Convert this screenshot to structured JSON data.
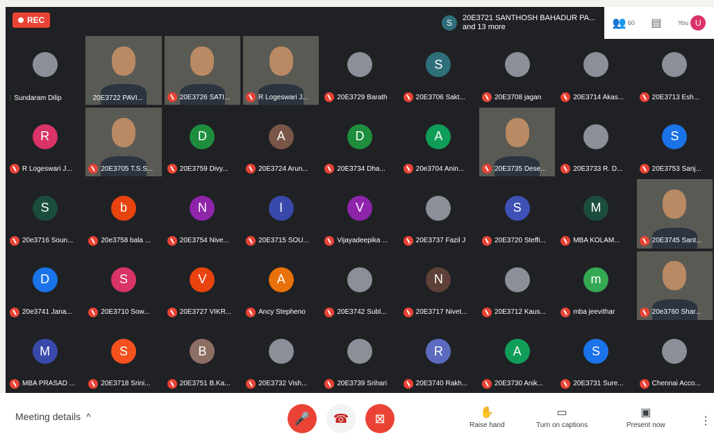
{
  "recording": {
    "label": "REC"
  },
  "presenters": {
    "initial": "S",
    "line1": "20E3721 SANTHOSH BAHADUR PA...",
    "line2": "and 13 more"
  },
  "top_right": {
    "people_count": "60",
    "you_label": "You",
    "you_initial": "U"
  },
  "participants": [
    {
      "name": "Sundaram Dilip",
      "type": "photo",
      "talking": true
    },
    {
      "name": "20E3722 PAVI...",
      "type": "video",
      "talking": true
    },
    {
      "name": "20E3726 SATI...",
      "type": "video"
    },
    {
      "name": "R Logeswari J...",
      "type": "video"
    },
    {
      "name": "20E3729 Barath",
      "type": "photo"
    },
    {
      "name": "20E3706 Sakt...",
      "type": "initial",
      "initial": "S",
      "color": "#2f6f7a"
    },
    {
      "name": "20E3708 jagan",
      "type": "photo"
    },
    {
      "name": "20E3714 Akas...",
      "type": "photo"
    },
    {
      "name": "20E3713 Esh...",
      "type": "photo"
    },
    {
      "name": "R Logeswari J...",
      "type": "initial",
      "initial": "R",
      "color": "#d93368"
    },
    {
      "name": "20E3705 T.S.S...",
      "type": "video"
    },
    {
      "name": "20E3759 Divy...",
      "type": "initial",
      "initial": "D",
      "color": "#1e8e3e"
    },
    {
      "name": "20E3724 Arun...",
      "type": "initial",
      "initial": "A",
      "color": "#795548"
    },
    {
      "name": "20E3734 Dha...",
      "type": "initial",
      "initial": "D",
      "color": "#1e8e3e"
    },
    {
      "name": "20e3704 Anin...",
      "type": "initial",
      "initial": "A",
      "color": "#0f9d58"
    },
    {
      "name": "20E3735 Dese...",
      "type": "video"
    },
    {
      "name": "20E3733 R. D...",
      "type": "photo"
    },
    {
      "name": "20E3753 Sanj...",
      "type": "initial",
      "initial": "S",
      "color": "#1a73e8"
    },
    {
      "name": "20e3716 Soun...",
      "type": "initial",
      "initial": "S",
      "color": "#1b4d3e"
    },
    {
      "name": "20e3758 bala ...",
      "type": "initial",
      "initial": "b",
      "color": "#e8430f"
    },
    {
      "name": "20E3754 Nive...",
      "type": "initial",
      "initial": "N",
      "color": "#8e24aa"
    },
    {
      "name": "20E3715 SOU...",
      "type": "initial",
      "initial": "I",
      "color": "#3949ab"
    },
    {
      "name": "Vijayadeepika ...",
      "type": "initial",
      "initial": "V",
      "color": "#8e24aa"
    },
    {
      "name": "20E3737 Fazil J",
      "type": "photo"
    },
    {
      "name": "20E3720 Steffi...",
      "type": "initial",
      "initial": "S",
      "color": "#3f51b5"
    },
    {
      "name": "MBA KOLAM...",
      "type": "initial",
      "initial": "M",
      "color": "#1b4d3e"
    },
    {
      "name": "20E3745 Sant...",
      "type": "video"
    },
    {
      "name": "20e3741 Jana...",
      "type": "initial",
      "initial": "D",
      "color": "#1a73e8"
    },
    {
      "name": "20E3710 Sow...",
      "type": "initial",
      "initial": "S",
      "color": "#d93368"
    },
    {
      "name": "20E3727 VIKR...",
      "type": "initial",
      "initial": "V",
      "color": "#e8430f"
    },
    {
      "name": "Ancy Stepheno",
      "type": "initial",
      "initial": "A",
      "color": "#e8710a"
    },
    {
      "name": "20E3742 Subl...",
      "type": "photo"
    },
    {
      "name": "20E3717 Nivet...",
      "type": "initial",
      "initial": "N",
      "color": "#5d4037"
    },
    {
      "name": "20E3712 Kaus...",
      "type": "photo"
    },
    {
      "name": "mba jeevithar",
      "type": "initial",
      "initial": "m",
      "color": "#34a853"
    },
    {
      "name": "20e3760 Shar...",
      "type": "video"
    },
    {
      "name": "MBA PRASAD ...",
      "type": "initial",
      "initial": "M",
      "color": "#3949ab"
    },
    {
      "name": "20E3718 Srini...",
      "type": "initial",
      "initial": "S",
      "color": "#f4511e"
    },
    {
      "name": "20E3751 B.Ka...",
      "type": "initial",
      "initial": "B",
      "color": "#8d6e63"
    },
    {
      "name": "20E3732 Vish...",
      "type": "photo"
    },
    {
      "name": "20E3739 Srihari",
      "type": "photo"
    },
    {
      "name": "20E3740 Rakh...",
      "type": "initial",
      "initial": "R",
      "color": "#5c6bc0"
    },
    {
      "name": "20E3730 Anik...",
      "type": "initial",
      "initial": "A",
      "color": "#0f9d58"
    },
    {
      "name": "20E3731 Sure...",
      "type": "initial",
      "initial": "S",
      "color": "#1a73e8"
    },
    {
      "name": "Chennai Acco...",
      "type": "photo"
    }
  ],
  "bottom_bar": {
    "meeting_details": "Meeting details",
    "raise_hand": "Raise hand",
    "captions": "Turn on captions",
    "present": "Present now"
  },
  "icons": {
    "mic_off": "mic-off-icon",
    "hangup": "hangup-icon",
    "cam_off": "camera-off-icon"
  }
}
